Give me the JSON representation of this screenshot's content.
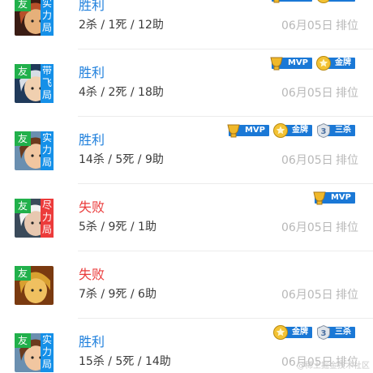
{
  "matches": [
    {
      "you_tag": "友",
      "mode_tag": "实力局",
      "mode_color": "blue",
      "result": "胜利",
      "result_type": "win",
      "kda": "2杀 / 1死 / 12助",
      "date": "06月05日",
      "rank": "排位",
      "hero_icon": "warrior-hero-avatar",
      "badges": [
        {
          "label": "MVP",
          "icon": "mvp-trophy-icon"
        },
        {
          "label": "金牌",
          "icon": "gold-medal-icon"
        }
      ]
    },
    {
      "you_tag": "友",
      "mode_tag": "带飞局",
      "mode_color": "blue",
      "result": "胜利",
      "result_type": "win",
      "kda": "4杀 / 2死 / 18助",
      "date": "06月05日",
      "rank": "排位",
      "hero_icon": "silver-hair-hero-avatar",
      "badges": [
        {
          "label": "MVP",
          "icon": "mvp-trophy-icon"
        },
        {
          "label": "金牌",
          "icon": "gold-medal-icon"
        }
      ]
    },
    {
      "you_tag": "友",
      "mode_tag": "实力局",
      "mode_color": "blue",
      "result": "胜利",
      "result_type": "win",
      "kda": "14杀 / 5死 / 9助",
      "date": "06月05日",
      "rank": "排位",
      "hero_icon": "brown-hair-hero-avatar",
      "badges": [
        {
          "label": "MVP",
          "icon": "mvp-trophy-icon"
        },
        {
          "label": "金牌",
          "icon": "gold-medal-icon"
        },
        {
          "label": "三杀",
          "icon": "triple-kill-icon"
        }
      ]
    },
    {
      "you_tag": "友",
      "mode_tag": "尽力局",
      "mode_color": "red",
      "result": "失败",
      "result_type": "lose",
      "kda": "5杀 / 9死 / 1助",
      "date": "06月05日",
      "rank": "排位",
      "hero_icon": "white-hair-hero-avatar",
      "badges": [
        {
          "label": "MVP",
          "icon": "mvp-trophy-icon"
        }
      ]
    },
    {
      "you_tag": "友",
      "mode_tag": "",
      "mode_color": "none",
      "result": "失败",
      "result_type": "lose",
      "kda": "7杀 / 9死 / 6助",
      "date": "06月05日",
      "rank": "排位",
      "hero_icon": "monkey-king-hero-avatar",
      "badges": []
    },
    {
      "you_tag": "友",
      "mode_tag": "实力局",
      "mode_color": "blue",
      "result": "胜利",
      "result_type": "win",
      "kda": "15杀 / 5死 / 14助",
      "date": "06月05日",
      "rank": "排位",
      "hero_icon": "brown-hair-hero-avatar",
      "badges": [
        {
          "label": "金牌",
          "icon": "gold-medal-icon"
        },
        {
          "label": "三杀",
          "icon": "triple-kill-icon"
        }
      ]
    }
  ],
  "watermark": "@稀土掘金技术社区",
  "colors": {
    "win": "#1e7fdc",
    "lose": "#ea3b3b",
    "tag_green": "#21b04b",
    "tag_blue": "#1590e8",
    "tag_red": "#ec3b3b",
    "badge_blue": "#1a78d6"
  }
}
